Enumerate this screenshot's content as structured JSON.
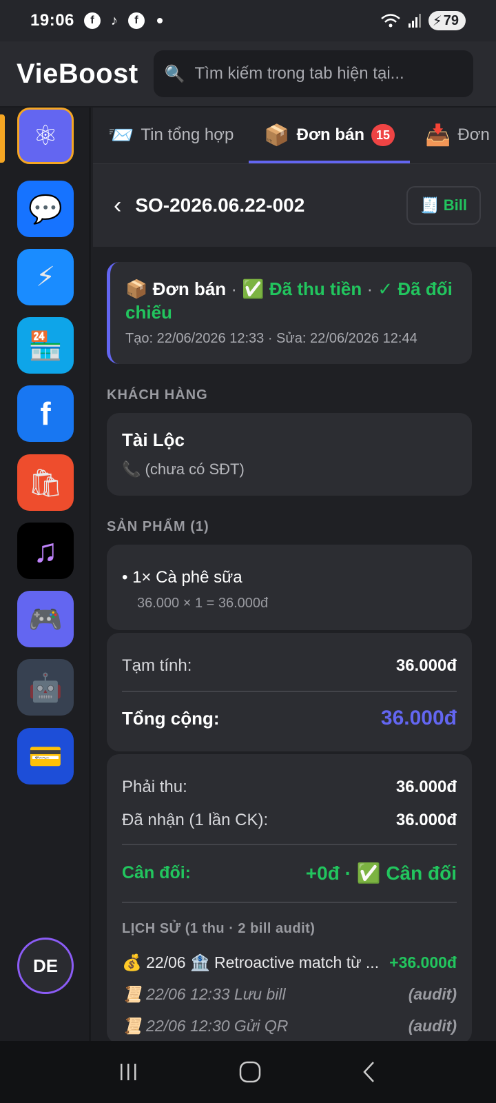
{
  "status_bar": {
    "time": "19:06",
    "notif_icons": [
      "facebook-icon",
      "tiktok-icon",
      "facebook-icon"
    ],
    "battery": "79"
  },
  "header": {
    "title": "VieBoost",
    "search_placeholder": "Tìm kiếm trong tab hiện tại..."
  },
  "sidebar": {
    "items": [
      {
        "name": "network-icon",
        "glyph": "⚛",
        "bg": "#6366f1",
        "active": true
      },
      {
        "name": "chat-icon",
        "glyph": "💬",
        "bg": "#1673ff"
      },
      {
        "name": "bolt-icon",
        "glyph": "⚡",
        "bg": "#1a8cff"
      },
      {
        "name": "store-24h-icon",
        "glyph": "🏪",
        "bg": "#0ea5e9"
      },
      {
        "name": "facebook-icon",
        "glyph": "f",
        "bg": "#1877f2"
      },
      {
        "name": "shopping-bags-icon",
        "glyph": "🛍",
        "bg": "#ee4d2d"
      },
      {
        "name": "music-icon",
        "glyph": "♫",
        "bg": "#000000"
      },
      {
        "name": "gamepad-icon",
        "glyph": "🎮",
        "bg": "#6366f1"
      },
      {
        "name": "robot-icon",
        "glyph": "🤖",
        "bg": "#374151"
      },
      {
        "name": "credit-card-icon",
        "glyph": "💳",
        "bg": "#1d4ed8"
      }
    ],
    "avatar": "DE"
  },
  "tabs": [
    {
      "emoji": "📨",
      "label": "Tin tổng hợp"
    },
    {
      "emoji": "📦",
      "label": "Đơn bán",
      "badge": "15",
      "active": true
    },
    {
      "emoji": "📥",
      "label": "Đơn"
    }
  ],
  "order": {
    "back": "‹",
    "id": "SO-2026.06.22-002",
    "bill_label": "Bill"
  },
  "status_card": {
    "type": "📦 Đơn bán",
    "sep": " · ",
    "paid": "✅ Đã thu tiền",
    "sep2": " · ",
    "reconciled": "✓ Đã đối chiếu",
    "meta": "Tạo: 22/06/2026 12:33 · Sửa: 22/06/2026 12:44"
  },
  "customer": {
    "section": "KHÁCH HÀNG",
    "name": "Tài Lộc",
    "phone": "📞 (chưa có SĐT)"
  },
  "products": {
    "section": "SẢN PHẨM (1)",
    "items": [
      {
        "name": "• 1× Cà phê sữa",
        "calc": "36.000 × 1 = 36.000đ"
      }
    ]
  },
  "totals": {
    "subtotal_label": "Tạm tính:",
    "subtotal": "36.000đ",
    "total_label": "Tổng cộng:",
    "total": "36.000đ"
  },
  "payment": {
    "due_label": "Phải thu:",
    "due": "36.000đ",
    "received_label": "Đã nhận (1 lần CK):",
    "received": "36.000đ",
    "balance_label": "Cân đối:",
    "balance": "+0đ · ✅ Cân đối"
  },
  "history": {
    "label": "LỊCH SỬ (1 thu · 2 bill audit)",
    "rows": [
      {
        "text": "💰 22/06 🏦 Retroactive match từ ...",
        "right": "+36.000đ",
        "kind": "amount"
      },
      {
        "text": "📜 22/06 12:33 Lưu bill",
        "right": "(audit)",
        "kind": "audit"
      },
      {
        "text": "📜 22/06 12:30 Gửi QR",
        "right": "(audit)",
        "kind": "audit"
      }
    ]
  },
  "colors": {
    "accent": "#6366f1",
    "success": "#22c55e",
    "badge": "#ef4444",
    "active_indicator": "#f5a623"
  }
}
